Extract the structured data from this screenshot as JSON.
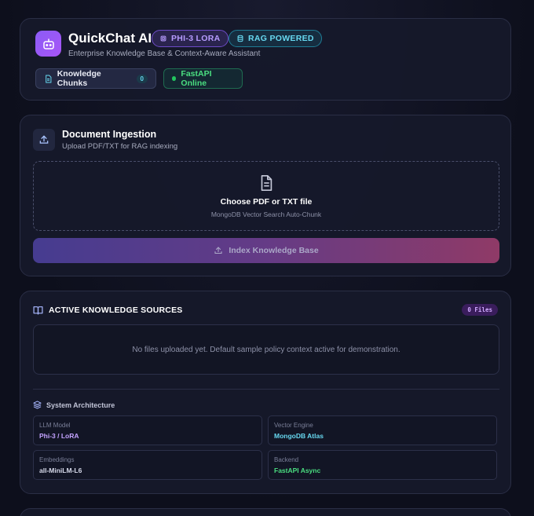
{
  "header": {
    "title": "QuickChat AI",
    "subtitle": "Enterprise Knowledge Base & Context-Aware Assistant",
    "badges": [
      {
        "label": "PHI-3 LORA",
        "icon": "chip-icon"
      },
      {
        "label": "RAG POWERED",
        "icon": "database-icon"
      }
    ],
    "chunks_label": "Knowledge Chunks",
    "chunks_count": "0",
    "api_status": "FastAPI Online"
  },
  "ingestion": {
    "title": "Document Ingestion",
    "subtitle": "Upload PDF/TXT for RAG indexing",
    "drop_title": "Choose PDF or TXT file",
    "drop_subtitle": "MongoDB Vector Search Auto-Chunk",
    "index_button": "Index Knowledge Base"
  },
  "sources": {
    "title": "ACTIVE KNOWLEDGE SOURCES",
    "files_badge": "0 Files",
    "empty_text": "No files uploaded yet. Default sample policy context active for demonstration.",
    "arch_title": "System Architecture",
    "arch": [
      {
        "label": "LLM Model",
        "value": "Phi-3 / LoRA",
        "color": "#c4a3ff"
      },
      {
        "label": "Vector Engine",
        "value": "MongoDB Atlas",
        "color": "#67d8f0"
      },
      {
        "label": "Embeddings",
        "value": "all-MiniLM-L6",
        "color": "#d7daea"
      },
      {
        "label": "Backend",
        "value": "FastAPI Async",
        "color": "#4ade80"
      }
    ]
  },
  "colors": {
    "accent": "#8b5cf6",
    "rag": "#67d8f0",
    "online": "#22c55e"
  }
}
